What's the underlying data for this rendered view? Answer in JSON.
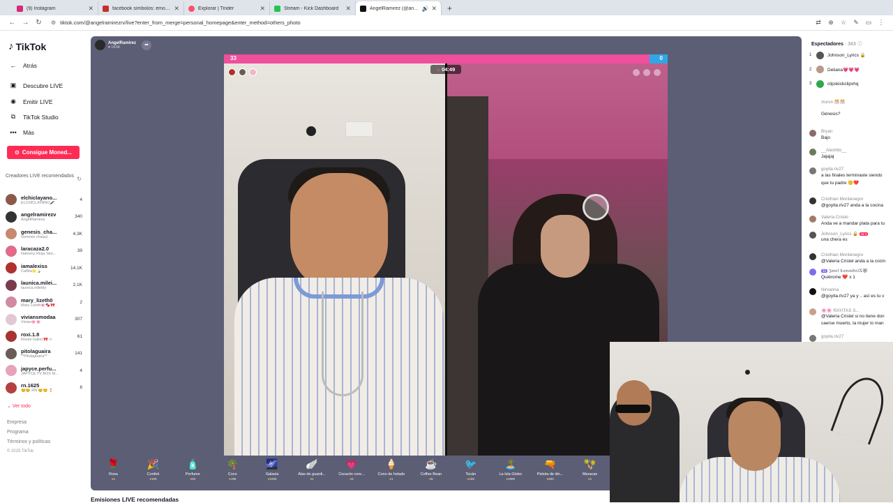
{
  "browser": {
    "tabs": [
      {
        "title": "(9) Instagram",
        "fav": "#d62976",
        "active": false
      },
      {
        "title": "facebook símbolos: emoticons",
        "fav": "#c4302b",
        "active": false
      },
      {
        "title": "Explorar | Tinder",
        "fav": "#fd5068",
        "active": false
      },
      {
        "title": "Stream - Kick Dashboard",
        "fav": "#23c552",
        "active": false
      },
      {
        "title": "AngelRamirez (@angelramirez",
        "fav": "#111111",
        "active": true
      }
    ],
    "new_tab": "+",
    "url": "tiktok.com/@angelramirezrv/live?enter_from_merge=personal_homepage&enter_method=others_photo"
  },
  "sidebar": {
    "logo": "TikTok",
    "back": "Atrás",
    "nav": [
      {
        "label": "Descubre LIVE",
        "icon": "live-icon"
      },
      {
        "label": "Emitir LIVE",
        "icon": "broadcast-icon"
      },
      {
        "label": "TikTok Studio",
        "icon": "studio-icon"
      },
      {
        "label": "Más",
        "icon": "more-icon"
      }
    ],
    "coins_button": "Consigue Moned...",
    "recommended_heading": "Creadores LIVE recomendados",
    "creators": [
      {
        "name": "elchiclayano...",
        "sub": "ELCHICLAYANO🎤",
        "count": "4",
        "color": "#8b5a4a"
      },
      {
        "name": "angelramirezv",
        "sub": "AngelRamirez",
        "count": "340",
        "color": "#333333"
      },
      {
        "name": "genesis_cha...",
        "sub": "Genesis chaqui",
        "count": "4.3K",
        "color": "#c78a6e"
      },
      {
        "name": "laracaza2.0",
        "sub": "Nahomy Rioja Stor...",
        "count": "39",
        "color": "#e06b8b"
      },
      {
        "name": "iamalexiss",
        "sub": "Cañita🌟🍃",
        "count": "14.1K",
        "color": "#b0302f"
      },
      {
        "name": "launica.milei...",
        "sub": "launica.mileidy",
        "count": "2.1K",
        "color": "#7b3c4e"
      },
      {
        "name": "mary_lizeth0",
        "sub": "Mary Lizeth🌸🍫🎀",
        "count": "2",
        "color": "#d28aa0"
      },
      {
        "name": "viviansmodaa",
        "sub": "Vivian🌸🌸",
        "count": "307",
        "color": "#e2c7d5"
      },
      {
        "name": "roxi.1.8",
        "sub": "Roxini Galini 🎀 ri",
        "count": "61",
        "color": "#a83333"
      },
      {
        "name": "pitolaguaira",
        "sub": "**Pitolaguaira**",
        "count": "141",
        "color": "#6a5d58"
      },
      {
        "name": "japyce.perfu...",
        "sub": "JAPYCE TV BOX M...",
        "count": "4",
        "color": "#e7a3b8"
      },
      {
        "name": "rn.1625",
        "sub": "😊😊 RN 😊😊 🎖️",
        "count": "8",
        "color": "#b54040"
      }
    ],
    "see_all": "Ver todo",
    "footer": [
      "Empresa",
      "Programa",
      "Términos y políticas"
    ],
    "copyright": "© 2025 TikTok"
  },
  "live": {
    "host_name": "AngelRamirez",
    "host_likes": "♥ 14.6K",
    "score_left": "33",
    "score_right": "0",
    "timer": "04:49",
    "gifts": [
      {
        "name": "Rosa",
        "price": "1",
        "icon": "🌹"
      },
      {
        "name": "Confeti",
        "price": "100",
        "icon": "🎉"
      },
      {
        "name": "Perfume",
        "price": "20",
        "icon": "🧴"
      },
      {
        "name": "Coco",
        "price": "199",
        "icon": "🌴"
      },
      {
        "name": "Galaxia",
        "price": "1000",
        "icon": "🌌"
      },
      {
        "name": "Alas de guardi...",
        "price": "1",
        "icon": "🪽"
      },
      {
        "name": "Corazón core...",
        "price": "5",
        "icon": "💗"
      },
      {
        "name": "Cono de helado",
        "price": "1",
        "icon": "🍦"
      },
      {
        "name": "Coffee Bean",
        "price": "5",
        "icon": "☕"
      },
      {
        "name": "Tocán",
        "price": "199",
        "icon": "🐦"
      },
      {
        "name": "La Isla Globo",
        "price": "1999",
        "icon": "🏝️"
      },
      {
        "name": "Pistola de din...",
        "price": "500",
        "icon": "🔫"
      },
      {
        "name": "Maracas",
        "price": "1",
        "icon": "🪇"
      }
    ],
    "recommended_below": "Emisiones LIVE recomendadas"
  },
  "viewers": {
    "label": "Espectadores",
    "count": "· 343",
    "top": [
      {
        "rank": "1",
        "name": "Johnson_Lyrics 🔒",
        "color": "#555555"
      },
      {
        "rank": "2",
        "name": "Deliana💗💗💗",
        "color": "#b89a8a"
      },
      {
        "rank": "3",
        "name": "clipskickclipxhq",
        "color": "#2fa84f"
      }
    ]
  },
  "chat": [
    {
      "user": "ziuron 🎊🎊",
      "msg": "",
      "color": "#ffffff"
    },
    {
      "user": "",
      "msg": "Génesis?",
      "color": "#ffffff"
    },
    {
      "user": "Bryan",
      "msg": "Bajo",
      "color": "#8a6b6b"
    },
    {
      "user": "__Alexhito__",
      "msg": "Jajajaj",
      "color": "#6b7a5a"
    },
    {
      "user": "goyita.riv27",
      "msg": "a las finales terminaste siendo",
      "msg2": "que tu padre 🙂❤️",
      "color": "#777777"
    },
    {
      "user": "Cristhian Montenegro",
      "msg": "@goyita.riv27 anda a la cocina",
      "color": "#333333"
    },
    {
      "user": "Valeria Cristel",
      "msg": "Anda ve a mandar plata para tu",
      "color": "#a07c6a"
    },
    {
      "user": "Johnson_Lyrics 🔒",
      "badge": "№ 2",
      "msg": "una chera es",
      "color": "#555555"
    },
    {
      "user": "Cristhian Montenegro",
      "msg": "@Valeria Cristel anda a la cocin",
      "color": "#333333"
    },
    {
      "user": "",
      "badge2": "34",
      "user2": "𝕵𝖆𝖓𝖊𝖑 𝕮𝖆𝖒𝖆𝖓𝖉𝖔𝟐𝐗🐺",
      "msg": "Quiérome ❤️ x 1",
      "color": "#7b6cf0"
    },
    {
      "user": "Nirvanna",
      "msg": "@goyita.riv27 ya y .. así es tu v",
      "color": "#111111"
    },
    {
      "user": "🌸🌸 RAYITAS S...",
      "msg": "@Valeria Cristel si no tiene don",
      "msg2": "caerse muerto, la mujer lo man",
      "color": "#c9a08a"
    },
    {
      "user": "goyita.riv27",
      "msg": "",
      "color": "#777777"
    }
  ]
}
